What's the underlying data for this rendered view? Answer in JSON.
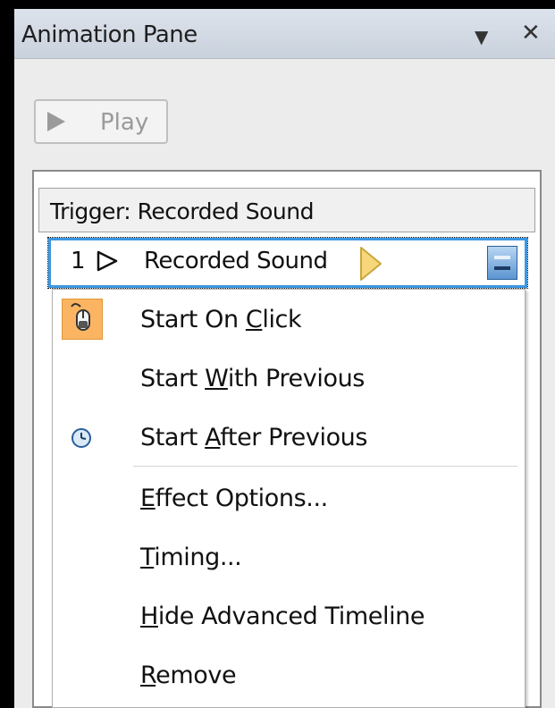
{
  "pane": {
    "title": "Animation Pane",
    "arrow_glyph": "▼",
    "close_glyph": "✕"
  },
  "toolbar": {
    "play_label": "Play"
  },
  "list": {
    "trigger_label": "Trigger: Recorded Sound",
    "effect": {
      "number": "1",
      "name": "Recorded Sound"
    }
  },
  "menu": {
    "items": [
      {
        "pre": "Start On ",
        "key": "C",
        "post": "lick",
        "icon": "mouse-click-icon",
        "checked": true
      },
      {
        "pre": "Start ",
        "key": "W",
        "post": "ith Previous",
        "icon": "",
        "checked": false
      },
      {
        "pre": "Start ",
        "key": "A",
        "post": "fter Previous",
        "icon": "clock-icon",
        "checked": false
      },
      {
        "pre": "",
        "key": "E",
        "post": "ffect Options...",
        "icon": "",
        "checked": false
      },
      {
        "pre": "",
        "key": "T",
        "post": "iming...",
        "icon": "",
        "checked": false
      },
      {
        "pre": "",
        "key": "H",
        "post": "ide Advanced Timeline",
        "icon": "",
        "checked": false
      },
      {
        "pre": "",
        "key": "R",
        "post": "emove",
        "icon": "",
        "checked": false
      }
    ]
  },
  "colors": {
    "selection_border": "#3c97e1",
    "checked_icon_bg": "#fbb461",
    "timing_bar": "#f7d77a"
  }
}
